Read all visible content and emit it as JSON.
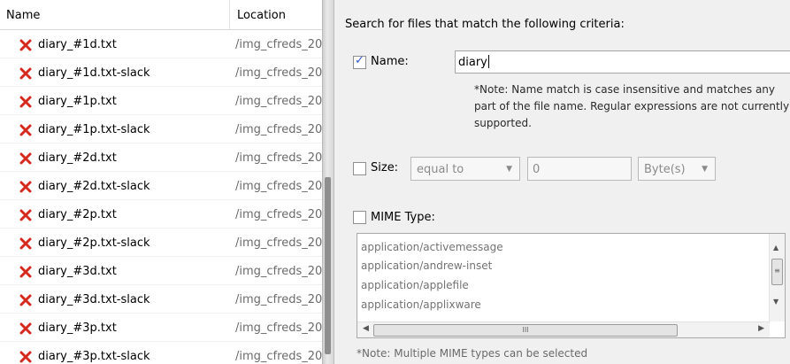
{
  "file_list": {
    "headers": {
      "name": "Name",
      "location": "Location"
    },
    "rows": [
      {
        "name": "diary_#1d.txt",
        "location": "/img_cfreds_20"
      },
      {
        "name": "diary_#1d.txt-slack",
        "location": "/img_cfreds_20"
      },
      {
        "name": "diary_#1p.txt",
        "location": "/img_cfreds_20"
      },
      {
        "name": "diary_#1p.txt-slack",
        "location": "/img_cfreds_20"
      },
      {
        "name": "diary_#2d.txt",
        "location": "/img_cfreds_20"
      },
      {
        "name": "diary_#2d.txt-slack",
        "location": "/img_cfreds_20"
      },
      {
        "name": "diary_#2p.txt",
        "location": "/img_cfreds_20"
      },
      {
        "name": "diary_#2p.txt-slack",
        "location": "/img_cfreds_20"
      },
      {
        "name": "diary_#3d.txt",
        "location": "/img_cfreds_20"
      },
      {
        "name": "diary_#3d.txt-slack",
        "location": "/img_cfreds_20"
      },
      {
        "name": "diary_#3p.txt",
        "location": "/img_cfreds_20"
      },
      {
        "name": "diary_#3p.txt-slack",
        "location": "/img_cfreds_20"
      }
    ],
    "file_icon": "deleted-file-icon",
    "icon_color": "#d42a1e"
  },
  "search": {
    "title": "Search for files that match the following criteria:",
    "name": {
      "label": "Name:",
      "checked": true,
      "value": "diary",
      "note": "*Note: Name match is case insensitive and matches any part of the file name. Regular expressions are not currently supported."
    },
    "size": {
      "label": "Size:",
      "checked": false,
      "comparator": "equal to",
      "value": "0",
      "unit": "Byte(s)"
    },
    "mime": {
      "label": "MIME Type:",
      "checked": false,
      "options": [
        "application/activemessage",
        "application/andrew-inset",
        "application/applefile",
        "application/applixware"
      ],
      "note": "*Note: Multiple MIME types can be selected"
    }
  }
}
